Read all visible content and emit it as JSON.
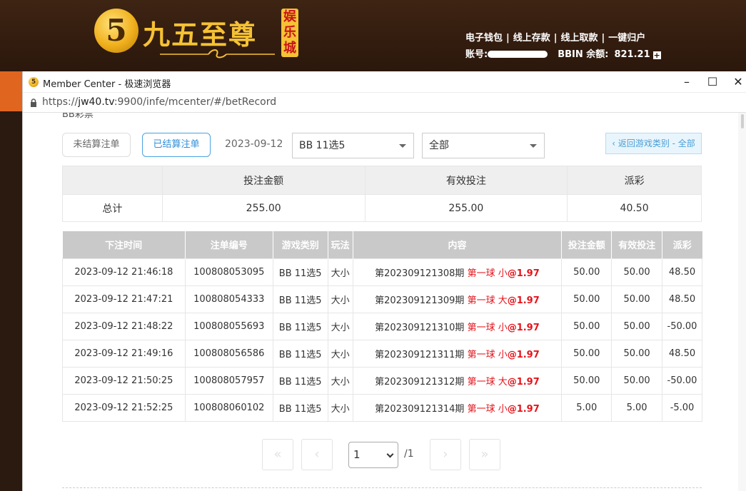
{
  "site": {
    "logo_mark": "5",
    "logo_text": "九五至尊",
    "logo_badge": "娱乐城",
    "nav": [
      "电子钱包",
      "线上存款",
      "线上取款",
      "一键归户"
    ],
    "nav_separator": "|",
    "account_label": "账号:",
    "balance_label": "BBIN 余额:",
    "balance": "821.21",
    "add_symbol": "+"
  },
  "browser": {
    "title": "Member Center - 极速浏览器",
    "url_prefix": "https://",
    "url_host": "jw40.tv",
    "url_rest": ":9900/infe/mcenter/#/betRecord",
    "minimize": "–",
    "maximize": "☐",
    "close": "✕"
  },
  "page": {
    "cut_title": "BB彩票",
    "tab_unsettled": "未结算注单",
    "tab_settled": "已结算注单",
    "date": "2023-09-12",
    "game_select": "BB 11选5",
    "type_select": "全部",
    "back_button": "‹ 返回游戏类别 - 全部"
  },
  "summary": {
    "headers": [
      "",
      "投注金额",
      "有效投注",
      "派彩"
    ],
    "row_label": "总计",
    "bet_amount": "255.00",
    "valid_bet": "255.00",
    "payout": "40.50"
  },
  "records": {
    "headers": [
      "下注时间",
      "注单编号",
      "游戏类别",
      "玩法",
      "内容",
      "投注金额",
      "有效投注",
      "派彩"
    ],
    "rows": [
      {
        "time": "2023-09-12 21:46:18",
        "id": "100808053095",
        "game": "BB 11选5",
        "play": "大小",
        "period": "第202309121308期",
        "pick": "第一球 小",
        "odds": "@1.97",
        "bet": "50.00",
        "valid": "50.00",
        "payout": "48.50"
      },
      {
        "time": "2023-09-12 21:47:21",
        "id": "100808054333",
        "game": "BB 11选5",
        "play": "大小",
        "period": "第202309121309期",
        "pick": "第一球 大",
        "odds": "@1.97",
        "bet": "50.00",
        "valid": "50.00",
        "payout": "48.50"
      },
      {
        "time": "2023-09-12 21:48:22",
        "id": "100808055693",
        "game": "BB 11选5",
        "play": "大小",
        "period": "第202309121310期",
        "pick": "第一球 小",
        "odds": "@1.97",
        "bet": "50.00",
        "valid": "50.00",
        "payout": "-50.00"
      },
      {
        "time": "2023-09-12 21:49:16",
        "id": "100808056586",
        "game": "BB 11选5",
        "play": "大小",
        "period": "第202309121311期",
        "pick": "第一球 小",
        "odds": "@1.97",
        "bet": "50.00",
        "valid": "50.00",
        "payout": "48.50"
      },
      {
        "time": "2023-09-12 21:50:25",
        "id": "100808057957",
        "game": "BB 11选5",
        "play": "大小",
        "period": "第202309121312期",
        "pick": "第一球 大",
        "odds": "@1.97",
        "bet": "50.00",
        "valid": "50.00",
        "payout": "-50.00"
      },
      {
        "time": "2023-09-12 21:52:25",
        "id": "100808060102",
        "game": "BB 11选5",
        "play": "大小",
        "period": "第202309121314期",
        "pick": "第一球 小",
        "odds": "@1.97",
        "bet": "5.00",
        "valid": "5.00",
        "payout": "-5.00"
      }
    ]
  },
  "pager": {
    "first": "«",
    "prev": "‹",
    "next": "›",
    "last": "»",
    "current": "1",
    "total": "/1"
  },
  "colors": {
    "accent": "#2f8fd8",
    "negative": "#e4141b",
    "header_bg": "#3a2114",
    "logo_gold": "#f6c234"
  }
}
